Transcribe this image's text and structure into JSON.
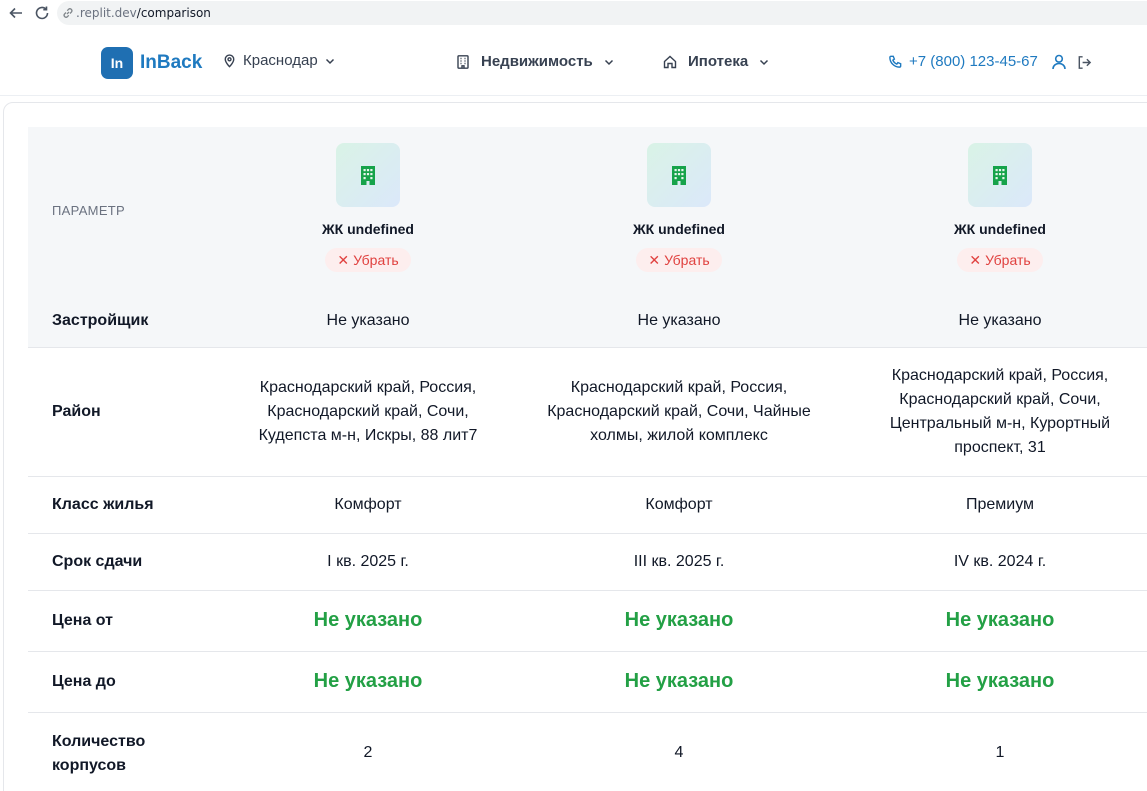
{
  "browser": {
    "url_host": ".replit.dev",
    "url_path": "/comparison"
  },
  "header": {
    "logo_mark": "In",
    "logo_text": "InBack",
    "city": "Краснодар",
    "menu": [
      {
        "label": "Недвижимость"
      },
      {
        "label": "Ипотека"
      }
    ],
    "phone": "+7 (800) 123-45-67"
  },
  "comparison": {
    "param_header": "ПАРАМЕТР",
    "remove_label": "Убрать",
    "columns": [
      {
        "name": "ЖК undefined"
      },
      {
        "name": "ЖК undefined"
      },
      {
        "name": "ЖК undefined"
      }
    ],
    "rows": [
      {
        "label": "Застройщик",
        "values": [
          "Не указано",
          "Не указано",
          "Не указано"
        ]
      },
      {
        "label": "Район",
        "values": [
          "Краснодарский край, Россия, Краснодарский край, Сочи, Кудепста м-н, Искры, 88 лит7",
          "Краснодарский край, Россия, Краснодарский край, Сочи, Чайные холмы, жилой комплекс",
          "Краснодарский край, Россия, Краснодарский край, Сочи, Центральный м-н, Курортный проспект, 31"
        ]
      },
      {
        "label": "Класс жилья",
        "values": [
          "Комфорт",
          "Комфорт",
          "Премиум"
        ]
      },
      {
        "label": "Срок сдачи",
        "values": [
          "I кв. 2025 г.",
          "III кв. 2025 г.",
          "IV кв. 2024 г."
        ]
      },
      {
        "label": "Цена от",
        "values": [
          "Не указано",
          "Не указано",
          "Не указано"
        ]
      },
      {
        "label": "Цена до",
        "values": [
          "Не указано",
          "Не указано",
          "Не указано"
        ]
      },
      {
        "label": "Количество корпусов",
        "values": [
          "2",
          "4",
          "1"
        ]
      }
    ]
  },
  "colors": {
    "brand_blue": "#1f7ac0",
    "price_green": "#23a045",
    "remove_red": "#e0413f"
  }
}
